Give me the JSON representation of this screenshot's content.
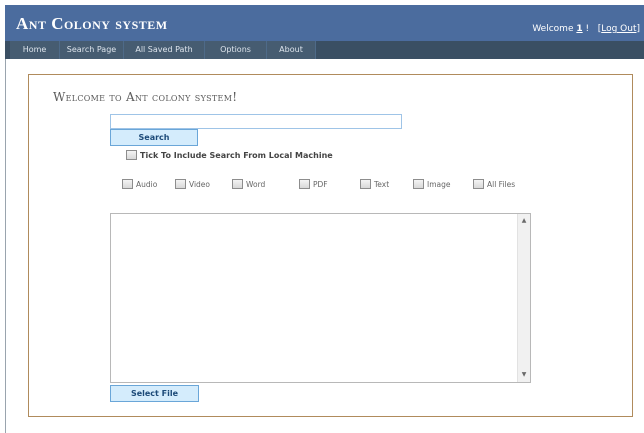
{
  "header": {
    "title": "Ant Colony system",
    "welcome_prefix": "Welcome",
    "user": "1",
    "exclaim": "!",
    "bracket_open": "[",
    "logout": "Log Out",
    "bracket_close": "]"
  },
  "menu": [
    "Home",
    "Search Page",
    "All Saved Path",
    "Options",
    "About"
  ],
  "main": {
    "heading": "Welcome to Ant colony system!",
    "search_value": "",
    "search_button": "Search",
    "local_checkbox_label": "Tick To Include Search From Local Machine",
    "file_types": [
      "Audio",
      "Video",
      "Word",
      "PDF",
      "Text",
      "Image",
      "All Files"
    ],
    "results_text": "",
    "select_file_button": "Select File"
  },
  "colors": {
    "header_bg": "#4b6c9e",
    "menubar_bg": "#3a4f63",
    "menu_item_bg": "#465c71",
    "panel_border": "#b08b5c",
    "button_bg": "#d4ecfc",
    "button_border": "#6aa6d8"
  },
  "icons": {
    "scroll_up": "▲",
    "scroll_down": "▼"
  }
}
